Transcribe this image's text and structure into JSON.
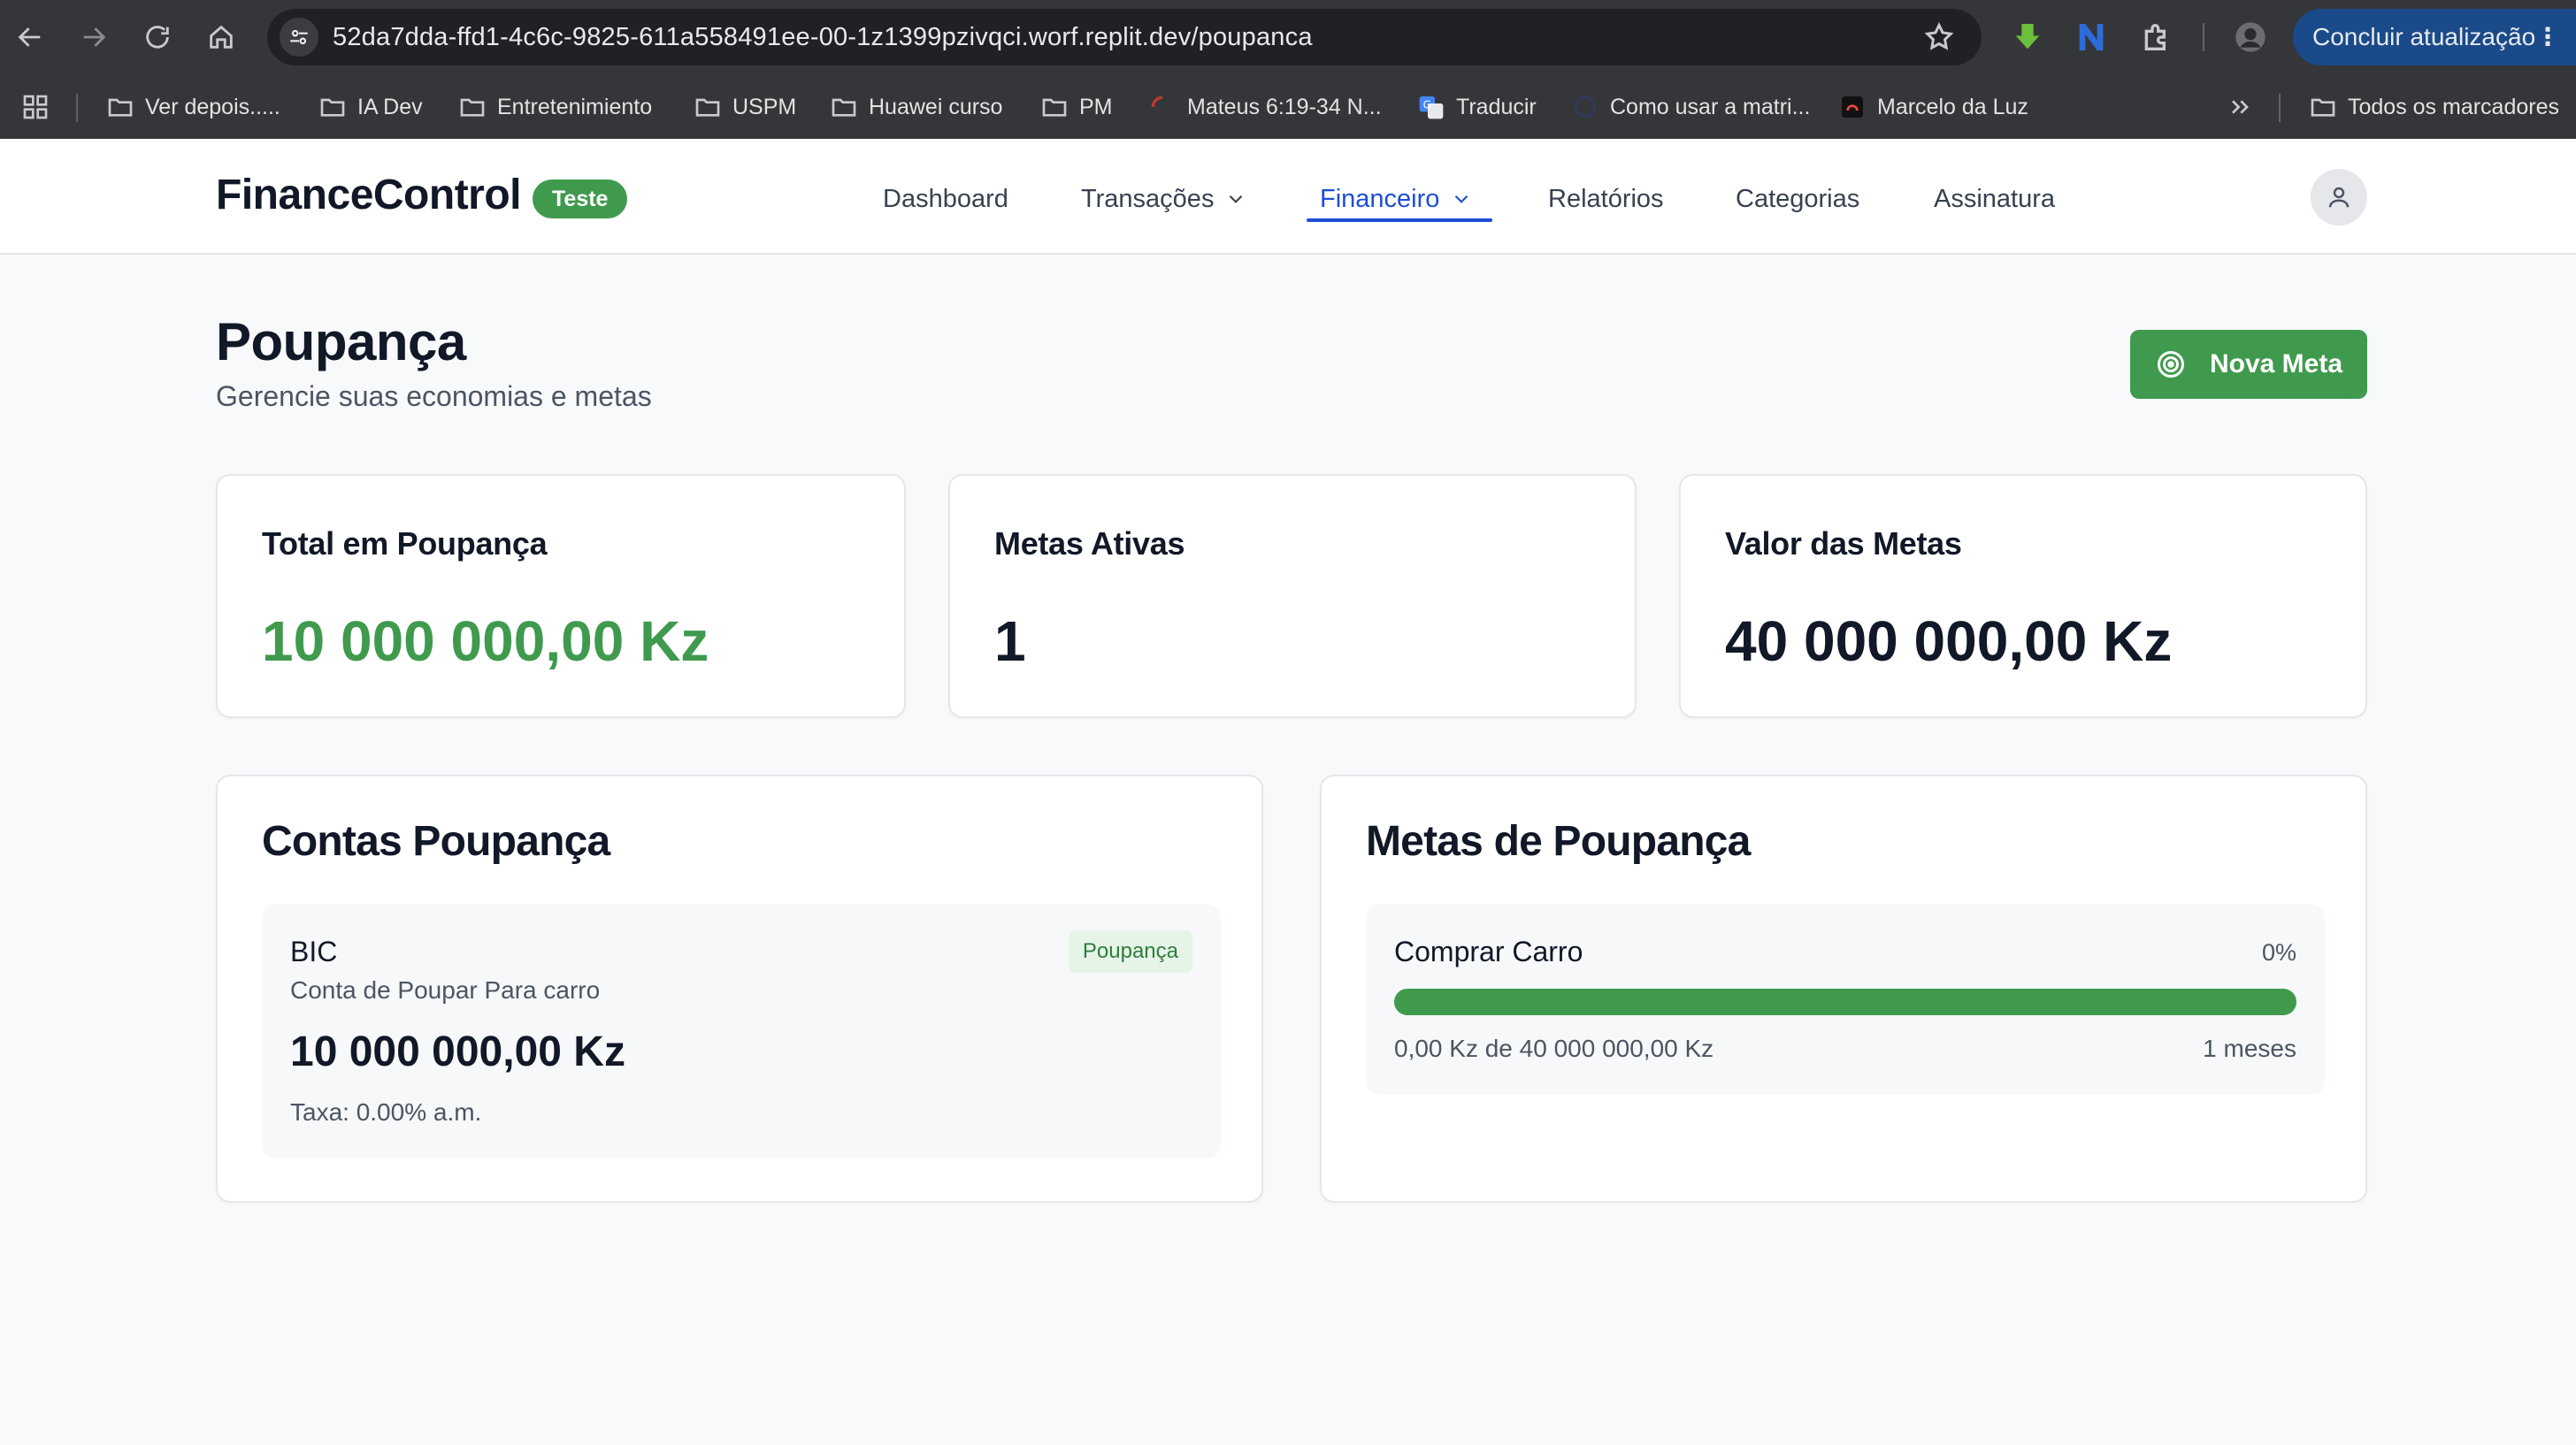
{
  "browser": {
    "url": "52da7dda-ffd1-4c6c-9825-611a558491ee-00-1z1399pzivqci.worf.replit.dev/poupanca",
    "update_label": "Concluir atualização",
    "bookmarks": [
      {
        "label": "Ver depois....."
      },
      {
        "label": "IA Dev"
      },
      {
        "label": "Entretenimiento"
      },
      {
        "label": "USPM"
      },
      {
        "label": "Huawei curso"
      },
      {
        "label": "PM"
      },
      {
        "label": "Mateus 6:19-34 N..."
      },
      {
        "label": "Traducir"
      },
      {
        "label": "Como usar a matri..."
      },
      {
        "label": "Marcelo da Luz"
      }
    ],
    "all_bookmarks_label": "Todos os marcadores"
  },
  "header": {
    "logo": "FinanceControl",
    "badge": "Teste",
    "nav": {
      "dashboard": "Dashboard",
      "transacoes": "Transações",
      "financeiro": "Financeiro",
      "relatorios": "Relatórios",
      "categorias": "Categorias",
      "assinatura": "Assinatura"
    }
  },
  "page": {
    "title": "Poupança",
    "subtitle": "Gerencie suas economias e metas",
    "new_goal_label": "Nova Meta"
  },
  "stats": {
    "total_label": "Total em Poupança",
    "total_value": "10 000 000,00 Kz",
    "active_label": "Metas Ativas",
    "active_value": "1",
    "goals_value_label": "Valor das Metas",
    "goals_value": "40 000 000,00 Kz"
  },
  "accounts": {
    "title": "Contas Poupança",
    "items": [
      {
        "name": "BIC",
        "tag": "Poupança",
        "description": "Conta de Poupar Para carro",
        "value": "10 000 000,00 Kz",
        "rate": "Taxa: 0.00% a.m."
      }
    ]
  },
  "goals": {
    "title": "Metas de Poupança",
    "items": [
      {
        "name": "Comprar Carro",
        "percent": "0%",
        "progress": 0,
        "amount": "0,00 Kz de 40 000 000,00 Kz",
        "time": "1 meses"
      }
    ]
  },
  "colors": {
    "brand_green": "#3f9a4d",
    "active_blue": "#1d4ed8",
    "update_button": "#1a4a8a"
  }
}
